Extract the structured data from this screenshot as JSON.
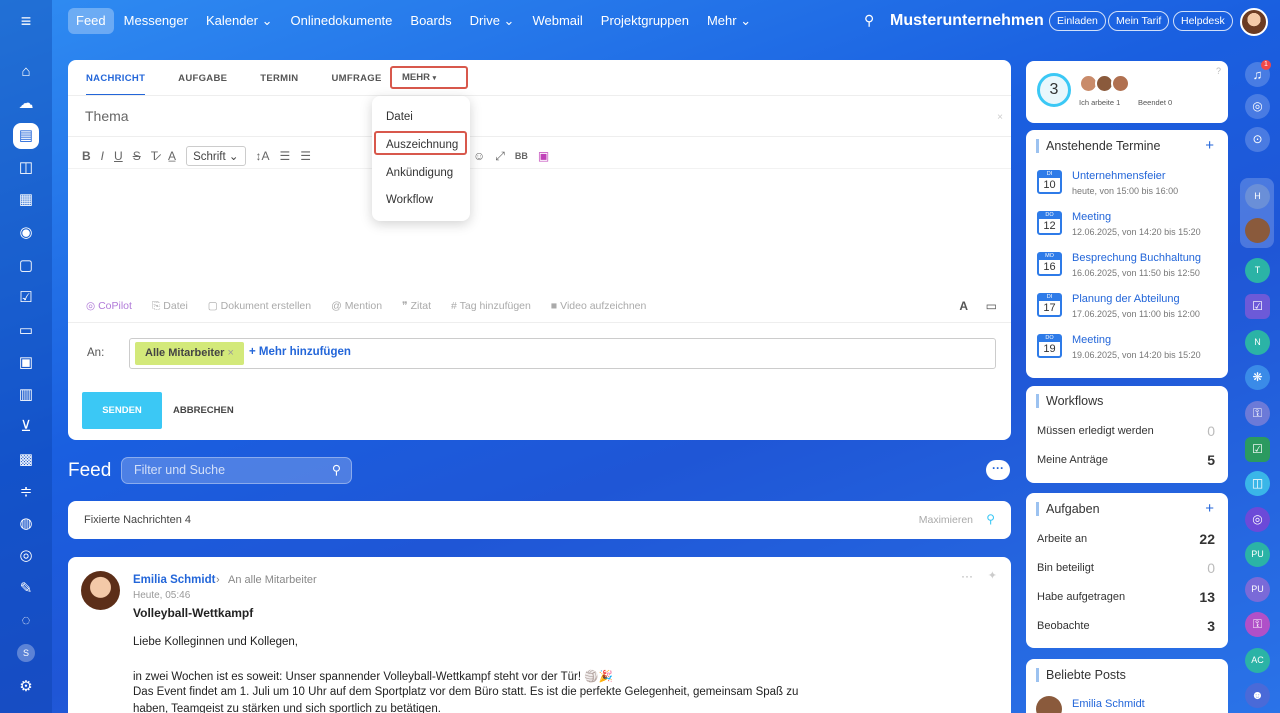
{
  "topnav": {
    "items": [
      "Feed",
      "Messenger",
      "Kalender ⌄",
      "Onlinedokumente",
      "Boards",
      "Drive ⌄",
      "Webmail",
      "Projektgruppen",
      "Mehr ⌄"
    ],
    "company": "Musterunternehmen",
    "buttons": [
      "Einladen",
      "Mein Tarif",
      "Helpdesk"
    ]
  },
  "composer": {
    "tabs": [
      "NACHRICHT",
      "AUFGABE",
      "TERMIN",
      "UMFRAGE"
    ],
    "more_label": "MEHR",
    "dropdown": [
      "Datei",
      "Auszeichnung",
      "Ankündigung",
      "Workflow"
    ],
    "subject_placeholder": "Thema",
    "font_label": "Schrift",
    "tools": [
      "CoPilot",
      "Datei",
      "Dokument erstellen",
      "Mention",
      "Zitat",
      "Tag hinzufügen",
      "Video aufzeichnen"
    ],
    "to_label": "An:",
    "recipient_tag": "Alle Mitarbeiter",
    "add_more": "+ Mehr hinzufügen",
    "send_label": "SENDEN",
    "cancel_label": "ABBRECHEN"
  },
  "feed": {
    "title": "Feed",
    "search_placeholder": "Filter und Suche",
    "pinned": "Fixierte Nachrichten 4",
    "maximize": "Maximieren"
  },
  "post": {
    "author": "Emilia Schmidt",
    "audience": "An alle Mitarbeiter",
    "time": "Heute, 05:46",
    "title": "Volleyball-Wettkampf",
    "greeting": "Liebe Kolleginnen und Kollegen,",
    "line1": "in zwei Wochen ist es soweit: Unser spannender Volleyball-Wettkampf steht vor der Tür! 🏐🎉",
    "line2": "Das Event findet am 1. Juli um 10 Uhr auf dem Sportplatz vor dem Büro statt. Es ist die perfekte Gelegenheit, gemeinsam Spaß zu",
    "line3": "haben, Teamgeist zu stärken und sich sportlich zu betätigen."
  },
  "status": {
    "count": "3",
    "working": "Ich arbeite 1",
    "done": "Beendet 0"
  },
  "events": {
    "title": "Anstehende Termine",
    "items": [
      {
        "day": "DI",
        "date": "10",
        "title": "Unternehmensfeier",
        "when": "heute, von 15:00 bis 16:00"
      },
      {
        "day": "DO",
        "date": "12",
        "title": "Meeting",
        "when": "12.06.2025, von 14:20 bis 15:20"
      },
      {
        "day": "MO",
        "date": "16",
        "title": "Besprechung Buchhaltung",
        "when": "16.06.2025, von 11:50 bis 12:50"
      },
      {
        "day": "DI",
        "date": "17",
        "title": "Planung der Abteilung",
        "when": "17.06.2025, von 11:00 bis 12:00"
      },
      {
        "day": "DO",
        "date": "19",
        "title": "Meeting",
        "when": "19.06.2025, von 14:20 bis 15:20"
      }
    ]
  },
  "workflows": {
    "title": "Workflows",
    "rows": [
      {
        "label": "Müssen erledigt werden",
        "value": "0"
      },
      {
        "label": "Meine Anträge",
        "value": "5"
      }
    ]
  },
  "tasks": {
    "title": "Aufgaben",
    "rows": [
      {
        "label": "Arbeite an",
        "value": "22"
      },
      {
        "label": "Bin beteiligt",
        "value": "0"
      },
      {
        "label": "Habe aufgetragen",
        "value": "13"
      },
      {
        "label": "Beobachte",
        "value": "3"
      }
    ]
  },
  "popular": {
    "title": "Beliebte Posts",
    "author": "Emilia Schmidt"
  },
  "rightbar": {
    "notif_badge": "1",
    "avatars": [
      "H",
      "T",
      "N",
      "PU",
      "PU",
      "AC"
    ]
  },
  "leftbar": {
    "user_initial": "S"
  }
}
